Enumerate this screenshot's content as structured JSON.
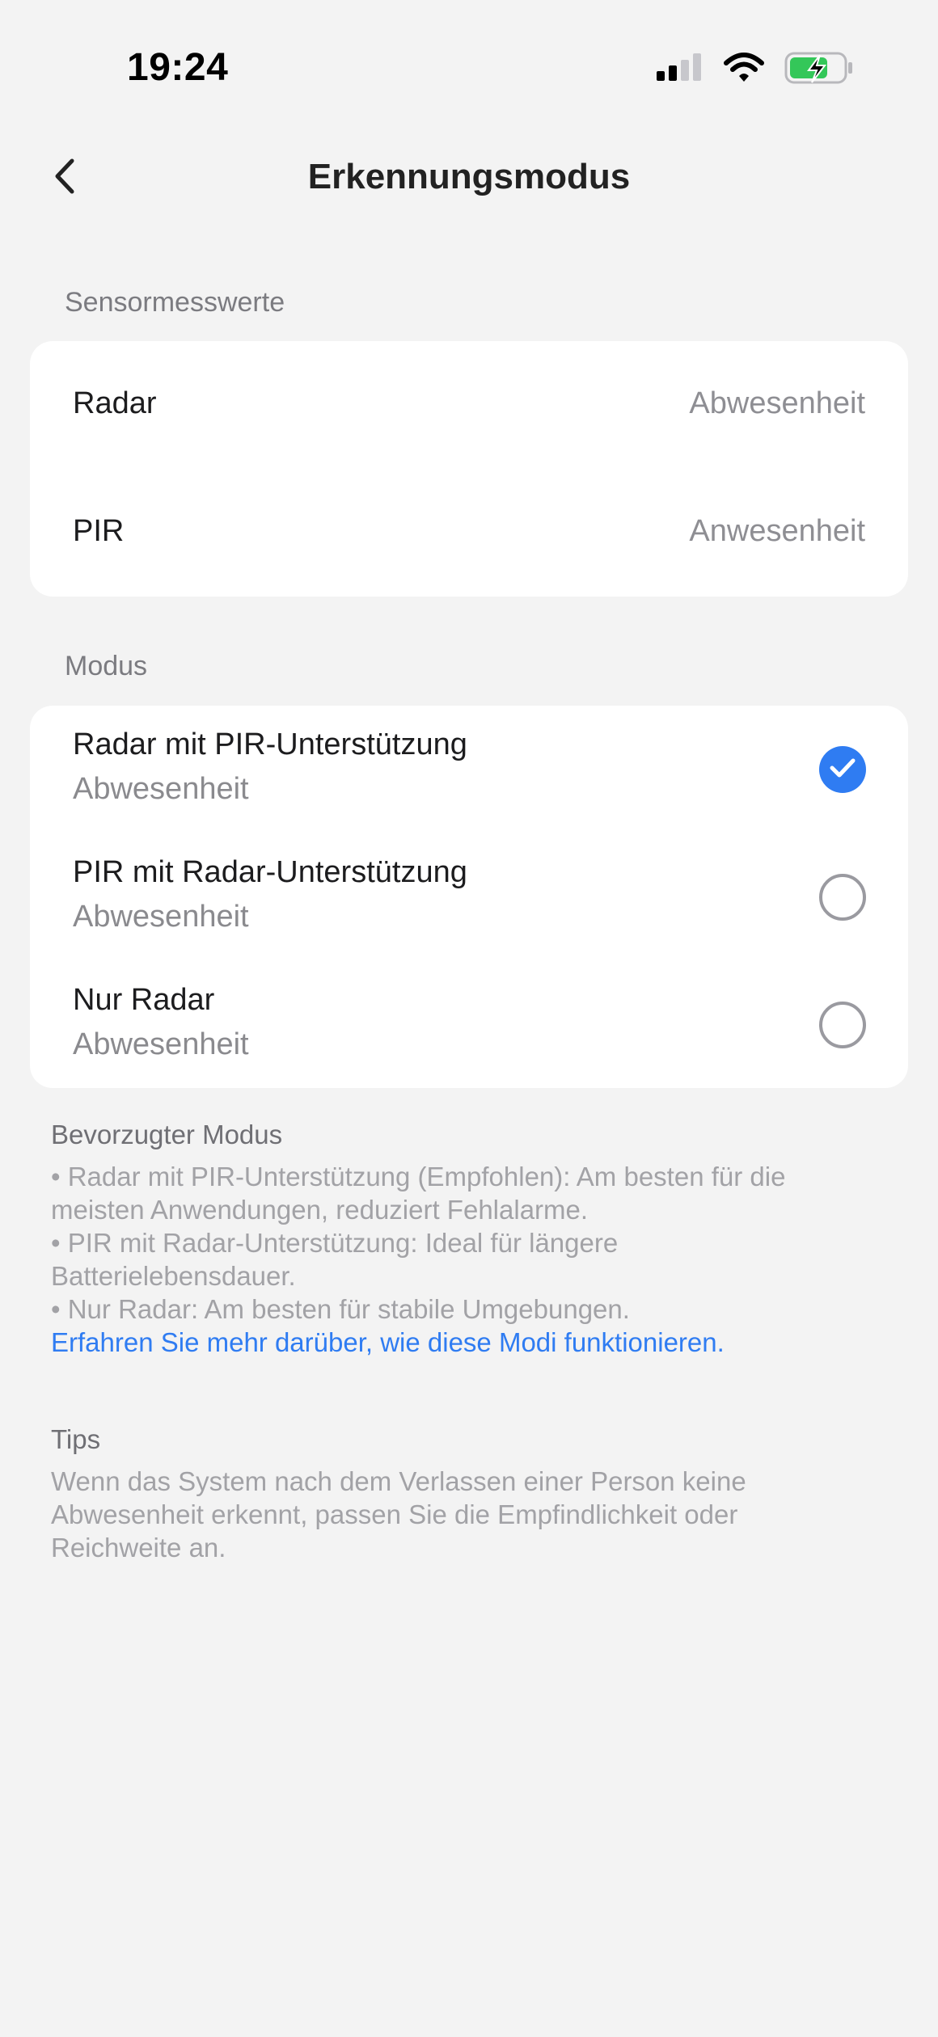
{
  "status_bar": {
    "time": "19:24",
    "icons": [
      "cellular-signal-icon",
      "wifi-icon",
      "battery-charging-icon"
    ]
  },
  "nav": {
    "back_icon": "chevron-left-icon",
    "title": "Erkennungsmodus"
  },
  "sensor_section": {
    "label": "Sensormesswerte",
    "rows": [
      {
        "label": "Radar",
        "value": "Abwesenheit"
      },
      {
        "label": "PIR",
        "value": "Anwesenheit"
      }
    ]
  },
  "mode_section": {
    "label": "Modus",
    "options": [
      {
        "title": "Radar mit PIR-Unterstützung",
        "subtitle": "Abwesenheit",
        "selected": true
      },
      {
        "title": "PIR mit Radar-Unterstützung",
        "subtitle": "Abwesenheit",
        "selected": false
      },
      {
        "title": "Nur Radar",
        "subtitle": "Abwesenheit",
        "selected": false
      }
    ]
  },
  "preferred": {
    "heading": "Bevorzugter Modus",
    "lines": [
      "• Radar mit PIR-Unterstützung (Empfohlen): Am besten für die",
      "meisten Anwendungen, reduziert Fehlalarme.",
      "• PIR mit Radar-Unterstützung: Ideal für längere",
      "Batterielebensdauer.",
      "• Nur Radar: Am besten für stabile Umgebungen."
    ],
    "link": "Erfahren Sie mehr darüber, wie diese Modi funktionieren."
  },
  "tips": {
    "heading": "Tips",
    "lines": [
      "Wenn das System nach dem Verlassen einer Person keine",
      "Abwesenheit erkennt, passen Sie die Empfindlichkeit oder",
      "Reichweite an."
    ]
  },
  "colors": {
    "background": "#f3f3f3",
    "card": "#ffffff",
    "accent": "#2f7cf2",
    "battery_green": "#34c759"
  }
}
